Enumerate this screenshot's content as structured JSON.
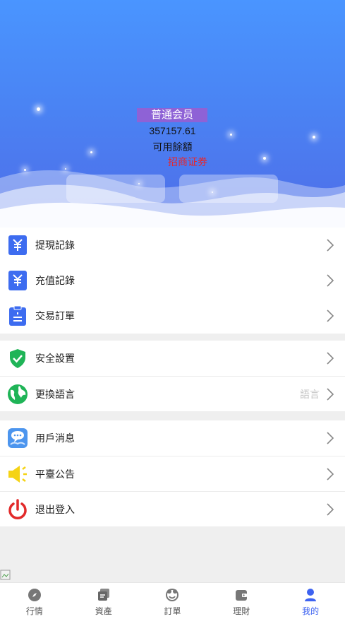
{
  "header": {
    "member_level": "普通会员",
    "balance": "357157.61",
    "balance_label": "可用餘額",
    "broker_name": "招商证券"
  },
  "menu_groups": [
    {
      "items": [
        {
          "label": "提現記錄",
          "icon": "yen-withdraw-icon"
        },
        {
          "label": "充值記錄",
          "icon": "yen-deposit-icon"
        },
        {
          "label": "交易訂單",
          "icon": "clipboard-icon"
        }
      ]
    },
    {
      "items": [
        {
          "label": "安全設置",
          "icon": "shield-check-icon"
        },
        {
          "label": "更換語言",
          "icon": "globe-icon",
          "hint": "語言"
        }
      ]
    },
    {
      "items": [
        {
          "label": "用戶消息",
          "icon": "chat-bubble-icon"
        },
        {
          "label": "平臺公告",
          "icon": "speaker-icon"
        },
        {
          "label": "退出登入",
          "icon": "power-icon"
        }
      ]
    }
  ],
  "tabbar": {
    "tabs": [
      {
        "label": "行情",
        "icon": "compass-icon"
      },
      {
        "label": "資產",
        "icon": "wallet-cards-icon"
      },
      {
        "label": "訂單",
        "icon": "order-icon"
      },
      {
        "label": "理財",
        "icon": "purse-icon"
      },
      {
        "label": "我的",
        "icon": "user-icon"
      }
    ],
    "active_index": 4
  },
  "colors": {
    "header_top": "#4a95ff",
    "header_bottom": "#4f6de8",
    "badge": "#8e62d6",
    "broker_red": "#e8252a",
    "active_tab": "#3e63f1"
  }
}
